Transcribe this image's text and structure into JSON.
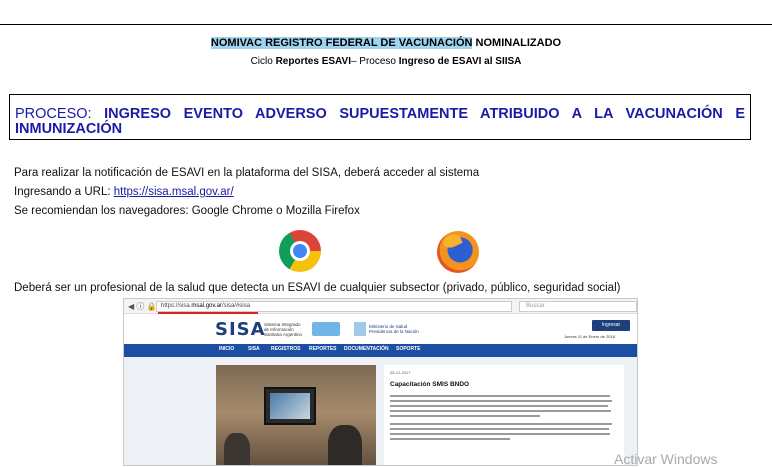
{
  "header": {
    "line1_highlight": "NOMIVAC REGISTRO FEDERAL DE VACUNACIÓN",
    "line1_rest": " NOMINALIZADO",
    "line2_a": "Ciclo ",
    "line2_b": "Reportes ESAVI",
    "line2_c": "– Proceso ",
    "line2_d": "Ingreso de ESAVI al SIISA"
  },
  "process": {
    "prefix": "PROCESO: ",
    "title": "INGRESO EVENTO ADVERSO SUPUESTAMENTE ATRIBUIDO A LA VACUNACIÓN E INMUNIZACIÓN"
  },
  "body": {
    "line1": "Para realizar la  notificación de ESAVI en la plataforma del SISA, deberá acceder al sistema",
    "line2_label": "Ingresando a URL:  ",
    "line2_url": "https://sisa.msal.gov.ar/",
    "line3": "Se recomiendan los navegadores: Google Chrome o Mozilla Firefox",
    "line4": "Deberá ser un profesional de la salud que detecta un ESAVI de cualquier subsector (privado, público, seguridad social)"
  },
  "browsers": [
    "chrome-icon",
    "firefox-icon"
  ],
  "embedded": {
    "nav_glyphs": "◀ ⓘ 🔒",
    "url_prefix": "https://sisa.",
    "url_host": "msal.gov.ar",
    "url_suffix": "/sisa/#sisa",
    "search_placeholder": "Buscar",
    "logo": "SISA",
    "logo_sub": "Sistema Integrado de Información Sanitaria Argentino",
    "ministry": "Ministerio de Salud Presidencia de la Nación",
    "login_label": "Ingresar",
    "date": "Jueves 11 de Enero de 2018",
    "nav": [
      "INICIO",
      "SISA",
      "REGISTROS",
      "REPORTES",
      "DOCUMENTACIÓN",
      "SOPORTE"
    ],
    "article_date": "06-12-2017",
    "article_title": "Capacitación SMIS BNDO"
  },
  "watermark": "Activar Windows",
  "colors": {
    "highlight": "#9fd3ee",
    "process_text": "#1a1aa6",
    "sisa_nav": "#1c4fa3",
    "sisa_brand": "#1d3f7c"
  }
}
